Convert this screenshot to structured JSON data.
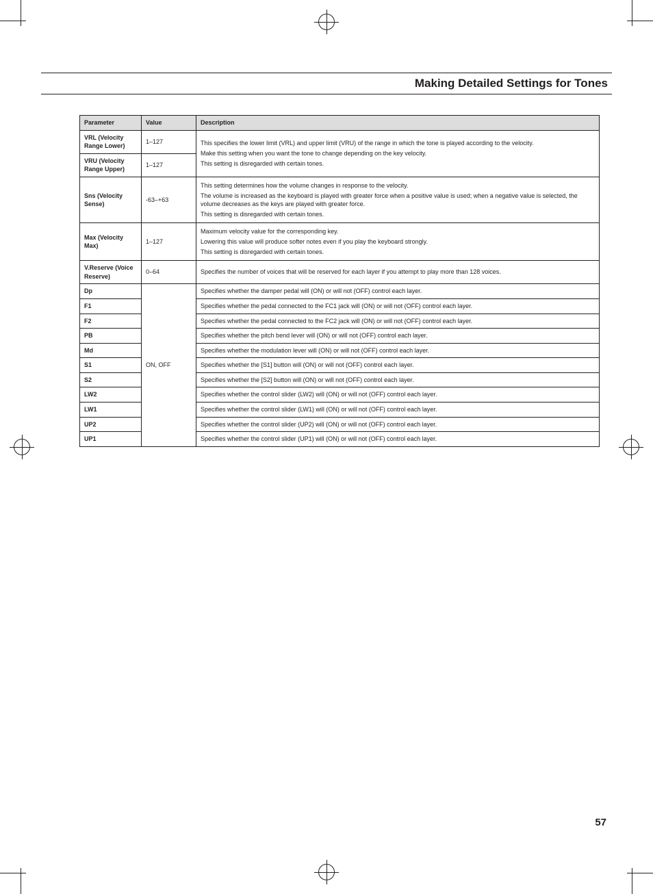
{
  "header": {
    "title": "Making Detailed Settings for Tones"
  },
  "page_number": "57",
  "table": {
    "headers": {
      "parameter": "Parameter",
      "value": "Value",
      "description": "Description"
    },
    "rows": {
      "vrl": {
        "param": "VRL (Velocity Range Lower)",
        "value": "1–127",
        "desc_l1": "This specifies the lower limit (VRL) and upper limit (VRU) of the range in which the tone is played according to the velocity.",
        "desc_l2": "Make this setting when you want the tone to change depending on the key velocity.",
        "desc_l3": "This setting is disregarded with certain tones."
      },
      "vru": {
        "param": "VRU (Velocity Range Upper)",
        "value": "1–127"
      },
      "sns": {
        "param": "Sns (Velocity Sense)",
        "value": "-63–+63",
        "desc_l1": "This setting determines how the volume changes in response to the velocity.",
        "desc_l2": "The volume is increased as the keyboard is played with greater force when a positive value is used; when a negative value is selected, the volume decreases as the keys are played with greater force.",
        "desc_l3": "This setting is disregarded with certain tones."
      },
      "max": {
        "param": "Max (Velocity Max)",
        "value": "1–127",
        "desc_l1": "Maximum velocity value for the corresponding key.",
        "desc_l2": "Lowering this value will produce softer notes even if you play the keyboard strongly.",
        "desc_l3": "This setting is disregarded with certain tones."
      },
      "vreserve": {
        "param": "V.Reserve (Voice Reserve)",
        "value": "0–64",
        "desc": "Specifies the number of voices that will be reserved for each layer if you attempt to play more than 128 voices."
      },
      "onoff_value": "ON, OFF",
      "dp": {
        "param": "Dp",
        "desc": "Specifies whether the damper pedal will (ON) or will not (OFF) control each layer."
      },
      "f1": {
        "param": "F1",
        "desc": "Specifies whether the pedal connected to the FC1 jack will (ON) or will not (OFF) control each layer."
      },
      "f2": {
        "param": "F2",
        "desc": "Specifies whether the pedal connected to the FC2 jack will (ON) or will not (OFF) control each layer."
      },
      "pb": {
        "param": "PB",
        "desc": "Specifies whether the pitch bend lever will (ON) or will not (OFF) control each layer."
      },
      "md": {
        "param": "Md",
        "desc": "Specifies whether the modulation lever will (ON) or will not (OFF) control each layer."
      },
      "s1": {
        "param": "S1",
        "desc": "Specifies whether the [S1] button will (ON) or will not (OFF) control each layer."
      },
      "s2": {
        "param": "S2",
        "desc": "Specifies whether the [S2] button will (ON) or will not (OFF) control each layer."
      },
      "lw2": {
        "param": "LW2",
        "desc": "Specifies whether the control slider (LW2) will (ON) or will not (OFF) control each layer."
      },
      "lw1": {
        "param": "LW1",
        "desc": "Specifies whether the control slider (LW1) will (ON) or will not (OFF) control each layer."
      },
      "up2": {
        "param": "UP2",
        "desc": "Specifies whether the control slider (UP2) will (ON) or will not (OFF) control each layer."
      },
      "up1": {
        "param": "UP1",
        "desc": "Specifies whether the control slider (UP1) will (ON) or will not (OFF) control each layer."
      }
    }
  }
}
